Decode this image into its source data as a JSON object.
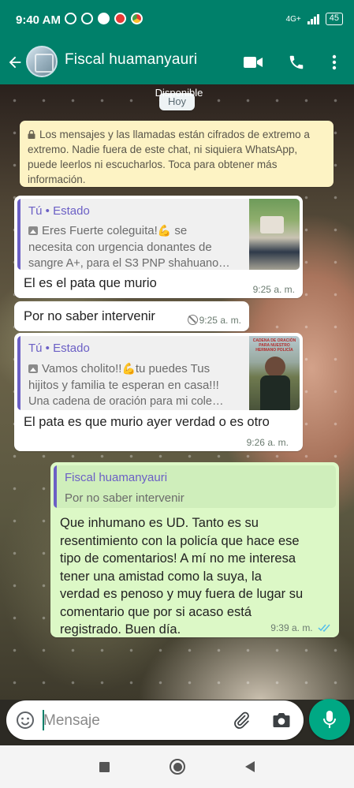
{
  "status_bar": {
    "time": "9:40 AM",
    "network": "4G+",
    "battery": "45"
  },
  "header": {
    "contact_name": "Fiscal huamanyauri",
    "status": "Disponible"
  },
  "date_chip": "Hoy",
  "encryption_notice": "Los mensajes y las llamadas están cifrados de extremo a extremo. Nadie fuera de este chat, ni siquiera WhatsApp, puede leerlos ni escucharlos. Toca para obtener más información.",
  "messages": [
    {
      "quote_author": "Tú • Estado",
      "quote_text_1": "Eres Fuerte coleguita!",
      "quote_text_1b": " se",
      "quote_text_2": "necesita con urgencia donantes de",
      "quote_text_3": "sangre A+, para el S3 PNP shahuano…",
      "text": "El es el pata que murio",
      "time": "9:25 a. m."
    },
    {
      "text": "Por no saber intervenir",
      "time": "9:25 a. m."
    },
    {
      "quote_author": "Tú • Estado",
      "quote_text_1": "Vamos cholito!!",
      "quote_text_1b": "tu puedes Tus",
      "quote_text_2": "hijitos y familia te esperan en casa!!!",
      "quote_text_3": "Una cadena de oración para mi cole…",
      "thumb_caption": "CADENA DE ORACIÓN PARA NUESTRO HERMANO POLICÍA",
      "text": "El pata es que murio ayer verdad o es otro",
      "time": "9:26 a. m."
    },
    {
      "quote_author": "Fiscal huamanyauri",
      "quote_text": "Por no saber intervenir",
      "lines": [
        "Que inhumano es UD. Tanto es su",
        "resentimiento con la policía que hace ese",
        "tipo de comentarios! A mí no me interesa",
        "tener una amistad como la suya, la",
        "verdad es penoso y muy fuera de lugar su",
        "comentario que por si acaso está",
        "registrado. Buen día."
      ],
      "time": "9:39 a. m."
    }
  ],
  "composer": {
    "placeholder": "Mensaje"
  },
  "icons": {
    "back": "arrow-left-icon",
    "video": "video-call-icon",
    "call": "phone-icon",
    "menu": "more-vertical-icon",
    "emoji": "emoji-icon",
    "attach": "paperclip-icon",
    "camera": "camera-icon",
    "mic": "microphone-icon"
  },
  "colors": {
    "header": "#00806a",
    "accent": "#00a884",
    "outgoing_bubble": "#dcf8c6",
    "quote_bar": "#6b5fc5",
    "read_ticks": "#53bdeb"
  }
}
